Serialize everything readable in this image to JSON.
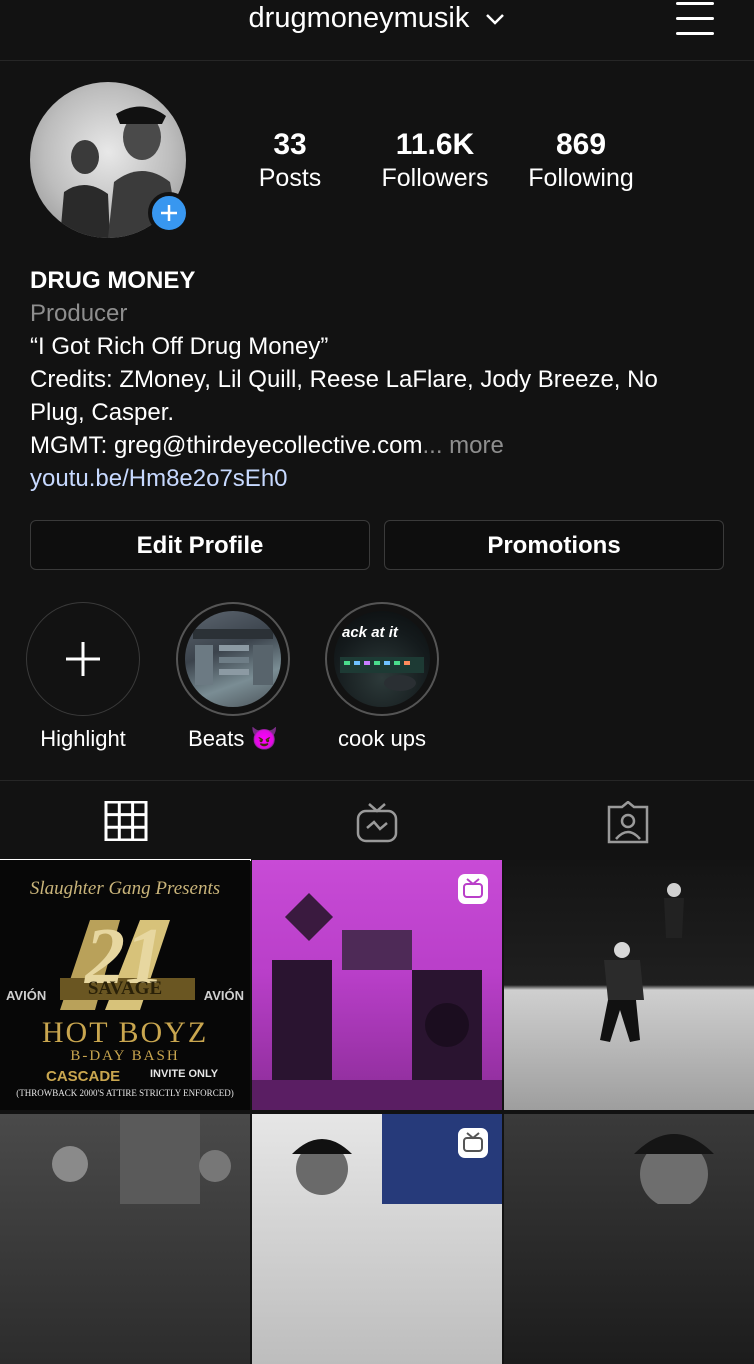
{
  "header": {
    "username": "drugmoneymusik"
  },
  "stats": [
    {
      "value": "33",
      "label": "Posts"
    },
    {
      "value": "11.6K",
      "label": "Followers"
    },
    {
      "value": "869",
      "label": "Following"
    }
  ],
  "bio": {
    "name": "DRUG MONEY",
    "category": "Producer",
    "line1": "“I Got Rich Off Drug Money”",
    "line2": "Credits: ZMoney, Lil Quill, Reese LaFlare, Jody Breeze, No",
    "line3": "Plug, Casper.",
    "line4": "MGMT: greg@thirdeyecollective.com",
    "ellipsis": "...",
    "more": "more",
    "link": "youtu.be/Hm8e2o7sEh0"
  },
  "buttons": {
    "edit_profile": "Edit Profile",
    "promotions": "Promotions"
  },
  "highlights": [
    {
      "label": "Highlight"
    },
    {
      "label": "Beats 😈"
    },
    {
      "label": "cook ups",
      "overlay_text": "ack at it"
    }
  ],
  "posts": [
    {
      "type": "poster",
      "top": "Slaughter Gang Presents",
      "number": "21",
      "sub": "SAVAGE",
      "brand_left": "AVIÓN",
      "brand_right": "AVIÓN",
      "title": "HOT BOYZ",
      "subtitle": "B-DAY BASH",
      "venue": "CASCADE",
      "invite": "INVITE ONLY",
      "footer": "(THROWBACK 2000'S ATTIRE STRICTLY ENFORCED)"
    },
    {
      "type": "igtv"
    },
    {
      "type": "photo"
    },
    {
      "type": "photo"
    },
    {
      "type": "igtv"
    },
    {
      "type": "photo"
    }
  ],
  "colors": {
    "background": "#121212",
    "accent": "#3897f0",
    "link": "#c7d9ff",
    "secondary_text": "#8e8e8e"
  }
}
